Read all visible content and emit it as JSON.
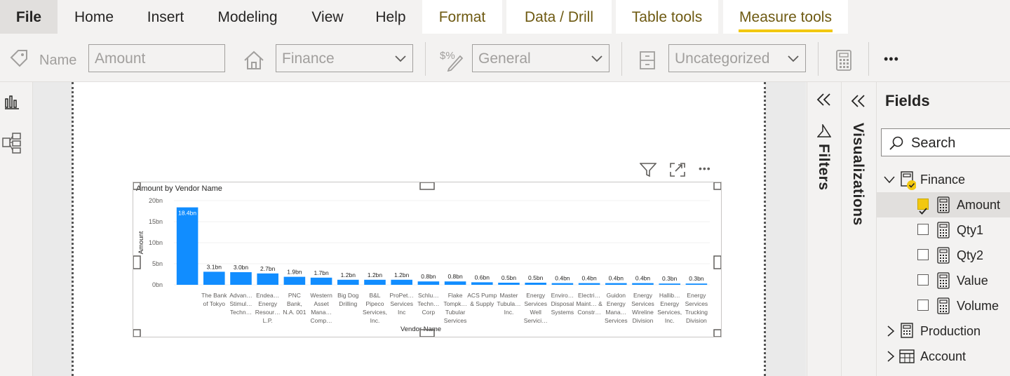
{
  "ribbon": {
    "tabs": [
      {
        "label": "File"
      },
      {
        "label": "Home"
      },
      {
        "label": "Insert"
      },
      {
        "label": "Modeling"
      },
      {
        "label": "View"
      },
      {
        "label": "Help"
      },
      {
        "label": "Format"
      },
      {
        "label": "Data / Drill"
      },
      {
        "label": "Table tools"
      },
      {
        "label": "Measure tools"
      }
    ],
    "active_tab": "Measure tools",
    "accent_color": "#f2c811"
  },
  "toolbar": {
    "name_label": "Name",
    "name_value": "Amount",
    "home_table_value": "Finance",
    "format_value": "General",
    "category_value": "Uncategorized",
    "more_label": "•••"
  },
  "visual": {
    "chart_data": {
      "type": "bar",
      "title": "Amount by Vendor Name",
      "xlabel": "Vendor Name",
      "ylabel": "Amount",
      "ylim": [
        0,
        20
      ],
      "yticks": [
        "0bn",
        "5bn",
        "10bn",
        "15bn",
        "20bn"
      ],
      "bar_color": "#118dff",
      "categories": [
        "",
        "The Bank of Tokyo",
        "Advan… Stimul… Techn…",
        "Endea… Energy Resour… L.P.",
        "PNC Bank, N.A. 001",
        "Western Asset Mana… Comp…",
        "Big Dog Drilling",
        "B&L Pipeco Services, Inc.",
        "ProPet… Services Inc",
        "Schlu… Techn… Corp",
        "Flake Tompk… Tubular Services",
        "ACS Pump & Supply",
        "Master Tubula… Inc.",
        "Energy Services Well Servici…",
        "Enviro… Disposal Systems",
        "Electri… Maint… & Constr…",
        "Guidon Energy Mana… Services",
        "Energy Services Wireline Division",
        "Hallib… Energy Services, Inc.",
        "Energy Services Trucking Division"
      ],
      "values": [
        18.4,
        3.1,
        3.0,
        2.7,
        1.9,
        1.7,
        1.2,
        1.2,
        1.2,
        0.8,
        0.8,
        0.6,
        0.5,
        0.5,
        0.4,
        0.4,
        0.4,
        0.4,
        0.3,
        0.3
      ],
      "data_labels": [
        "18.4bn",
        "3.1bn",
        "3.0bn",
        "2.7bn",
        "1.9bn",
        "1.7bn",
        "1.2bn",
        "1.2bn",
        "1.2bn",
        "0.8bn",
        "0.8bn",
        "0.6bn",
        "0.5bn",
        "0.5bn",
        "0.4bn",
        "0.4bn",
        "0.4bn",
        "0.4bn",
        "0.3bn",
        "0.3bn"
      ],
      "legend": "none",
      "grid": true
    }
  },
  "panes": {
    "filters_title": "Filters",
    "visualizations_title": "Visualizations",
    "fields_title": "Fields",
    "search_placeholder": "Search",
    "tables": [
      {
        "name": "Finance",
        "expanded": true,
        "fields": [
          {
            "name": "Amount",
            "checked": true
          },
          {
            "name": "Qty1",
            "checked": false
          },
          {
            "name": "Qty2",
            "checked": false
          },
          {
            "name": "Value",
            "checked": false
          },
          {
            "name": "Volume",
            "checked": false
          }
        ]
      },
      {
        "name": "Production",
        "expanded": false
      },
      {
        "name": "Account",
        "expanded": false
      }
    ]
  }
}
